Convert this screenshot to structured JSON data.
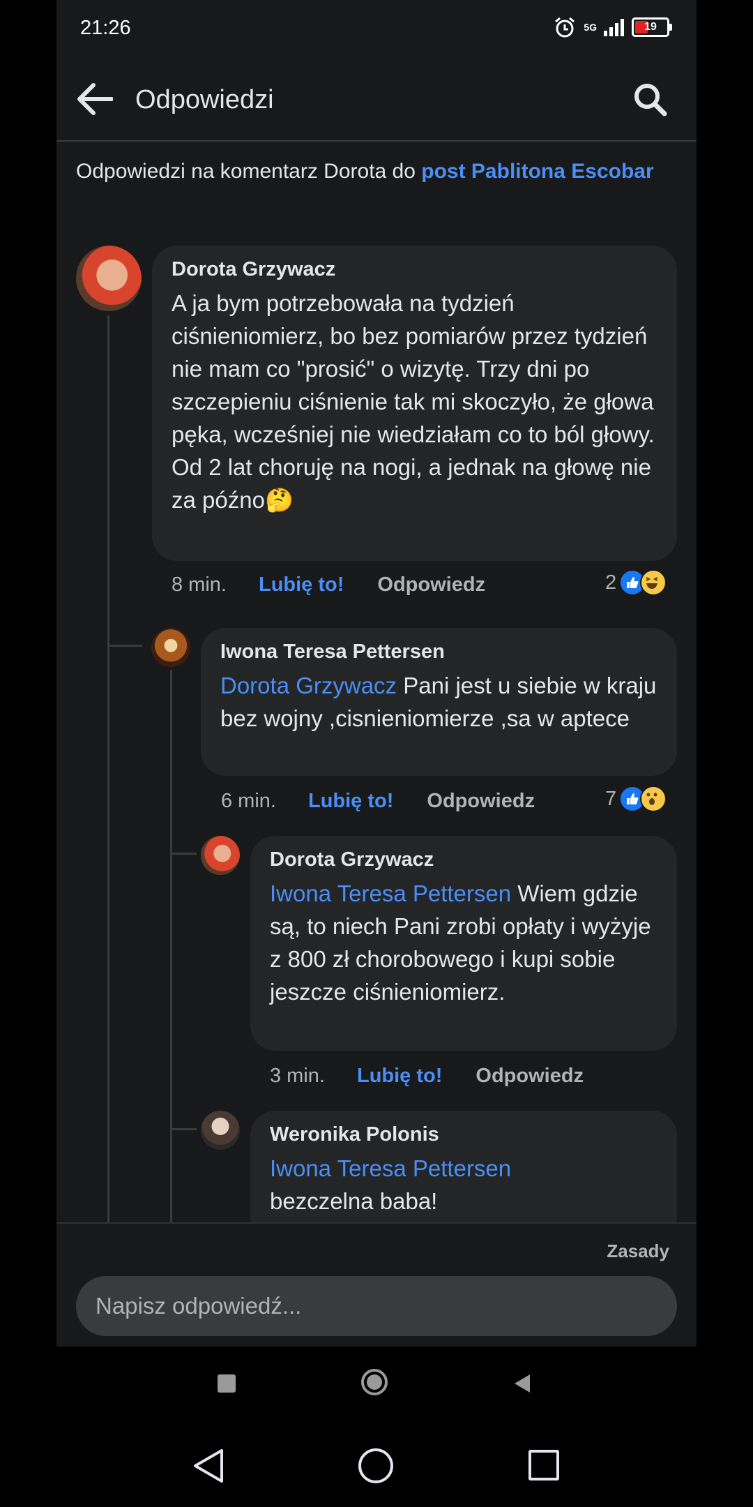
{
  "status_bar": {
    "time": "21:26",
    "network": "5G",
    "battery": "19"
  },
  "header": {
    "title": "Odpowiedzi"
  },
  "intro": {
    "prefix": "Odpowiedzi na komentarz Dorota do ",
    "link": "post Pablitona Escobar"
  },
  "comments": [
    {
      "author": "Dorota Grzywacz",
      "mention": "",
      "text": "A ja bym potrzebowała na tydzień ciśnieniomierz, bo bez pomiarów przez tydzień nie mam co \"prosić\" o wizytę. Trzy dni po szczepieniu ciśnienie tak mi skoczyło, że głowa pęka, wcześniej nie wiedziałam co to ból głowy. Od 2 lat choruję na nogi, a jednak na głowę nie za późno",
      "emoji": "🤔",
      "time": "8 min.",
      "like_label": "Lubię to!",
      "reply_label": "Odpowiedz",
      "reaction_count": "2"
    },
    {
      "author": "Iwona Teresa Pettersen",
      "mention": "Dorota Grzywacz",
      "text": " Pani jest u siebie w kraju bez wojny ,cisnieniomierze ,sa w aptece",
      "time": "6 min.",
      "like_label": "Lubię to!",
      "reply_label": "Odpowiedz",
      "reaction_count": "7"
    },
    {
      "author": "Dorota Grzywacz",
      "mention": "Iwona Teresa Pettersen",
      "text": " Wiem gdzie są, to niech Pani zrobi opłaty i wyżyje z 800 zł chorobowego i kupi sobie jeszcze ciśnieniomierz.",
      "time": "3 min.",
      "like_label": "Lubię to!",
      "reply_label": "Odpowiedz"
    },
    {
      "author": "Weronika Polonis",
      "mention": "Iwona Teresa Pettersen",
      "text": "bezczelna baba!"
    }
  ],
  "footer": {
    "rules_label": "Zasady",
    "reply_placeholder": "Napisz odpowiedź..."
  },
  "colors": {
    "background": "#18191a",
    "bubble": "#242526",
    "accent": "#4b8ef5"
  }
}
